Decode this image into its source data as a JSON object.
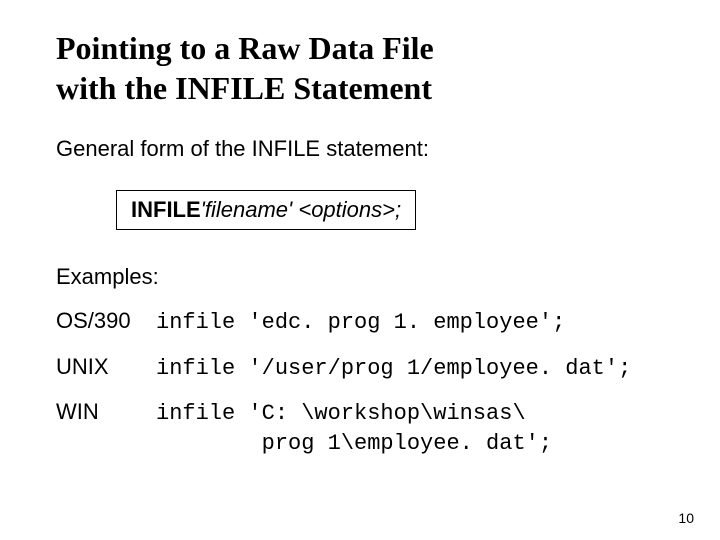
{
  "title_line1": "Pointing to a Raw Data File",
  "title_line2": "with the INFILE Statement",
  "intro": "General form of the INFILE statement:",
  "syntax": {
    "keyword": "INFILE",
    "args": "'filename' <options>;"
  },
  "examples_label": "Examples:",
  "examples": [
    {
      "os": "OS/390",
      "code": "infile 'edc. prog 1. employee';"
    },
    {
      "os": "UNIX",
      "code": "infile '/user/prog 1/employee. dat';"
    },
    {
      "os": "WIN",
      "code": "infile 'C: \\workshop\\winsas\\\n        prog 1\\employee. dat';"
    }
  ],
  "page_number": "10"
}
